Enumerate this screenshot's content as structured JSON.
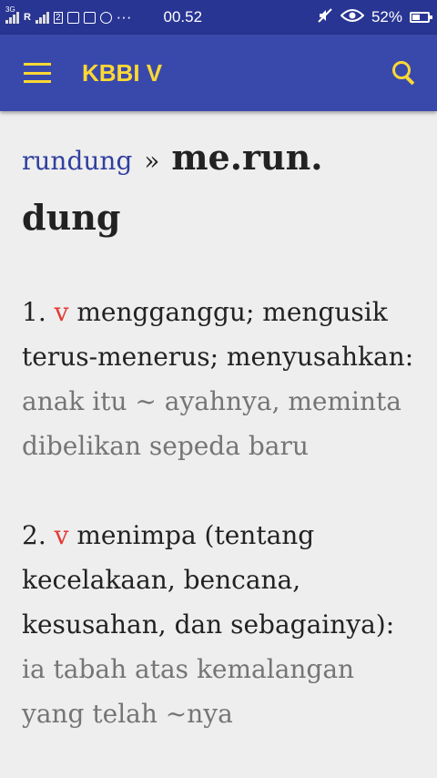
{
  "statusbar": {
    "network_type": "3G",
    "roaming_label": "R",
    "sim2_label": "2",
    "more_label": "···",
    "time": "00.52",
    "battery_text": "52%",
    "battery_level": 0.52
  },
  "appbar": {
    "title": "KBBI V"
  },
  "entry": {
    "root": "rundung",
    "separator": "»",
    "headword": "me.run.​dung",
    "definitions": [
      {
        "number": "1.",
        "pos": "v",
        "text": "mengganggu; mengusik terus-menerus; menyusahkan:",
        "example": "anak itu ~ ayahnya, meminta dibelikan sepeda baru"
      },
      {
        "number": "2.",
        "pos": "v",
        "text": "menimpa (tentang kecelakaan, bencana, kesusahan, dan sebagainya):",
        "example": "ia tabah atas kemalangan yang telah ~nya"
      }
    ]
  }
}
